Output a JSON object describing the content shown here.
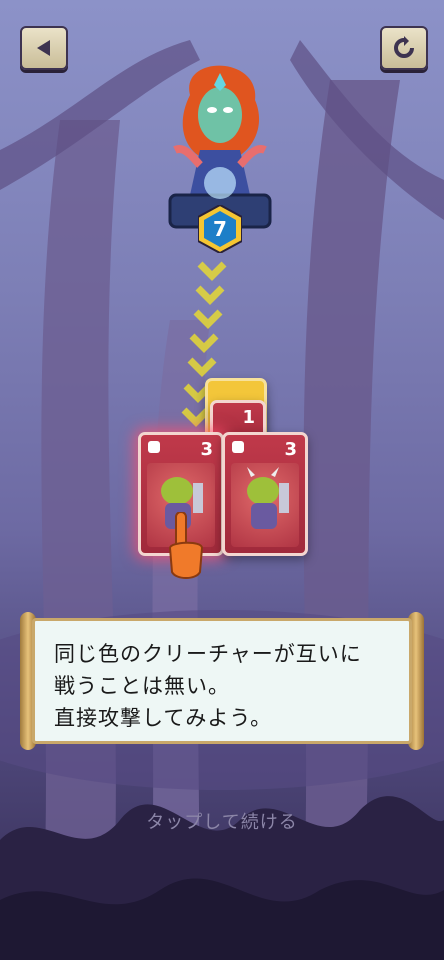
{
  "header": {
    "back_icon": "back-arrow-icon",
    "restart_icon": "restart-icon"
  },
  "hero": {
    "power": "7",
    "badge_color": "#1d7fc8"
  },
  "cards": {
    "back_card_cost": "1",
    "left_card_cost": "3",
    "right_card_cost": "3",
    "card_color": "#b8323f"
  },
  "dialog": {
    "line1": "同じ色のクリーチャーが互いに",
    "line2": "戦うことは無い。",
    "line3": "直接攻撃してみよう。"
  },
  "footer": {
    "tap_to_continue": "タップして続ける"
  }
}
